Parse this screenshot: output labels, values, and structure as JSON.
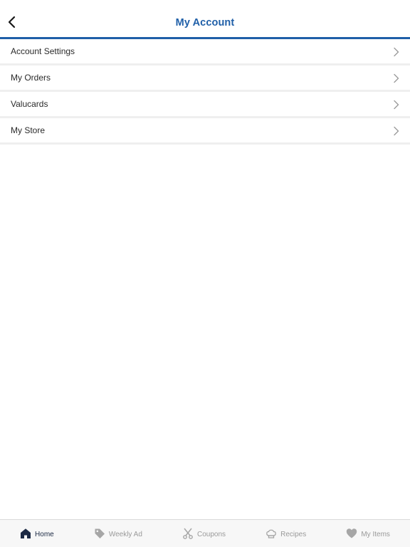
{
  "header": {
    "title": "My Account",
    "back_icon": "chevron-left-icon"
  },
  "menu": {
    "items": [
      {
        "label": "Account Settings",
        "icon": "chevron-right-icon"
      },
      {
        "label": "My Orders",
        "icon": "chevron-right-icon"
      },
      {
        "label": "Valucards",
        "icon": "chevron-right-icon"
      },
      {
        "label": "My Store",
        "icon": "chevron-right-icon"
      }
    ]
  },
  "tabs": [
    {
      "label": "Home",
      "icon": "home-icon",
      "active": true
    },
    {
      "label": "Weekly Ad",
      "icon": "tag-icon",
      "active": false
    },
    {
      "label": "Coupons",
      "icon": "scissors-icon",
      "active": false
    },
    {
      "label": "Recipes",
      "icon": "chef-hat-icon",
      "active": false
    },
    {
      "label": "My Items",
      "icon": "heart-icon",
      "active": false
    }
  ],
  "colors": {
    "accent": "#1f5fa8",
    "tab_active": "#1c2a44",
    "tab_inactive": "#9a9a9a",
    "separator": "#efefef"
  }
}
